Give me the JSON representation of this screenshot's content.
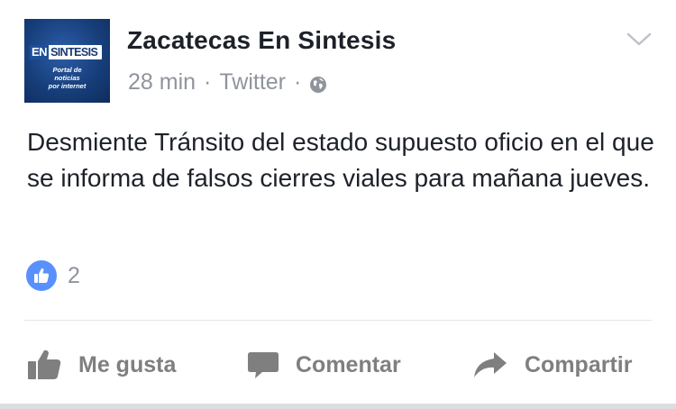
{
  "post": {
    "page_name": "Zacatecas En Sintesis",
    "time": "28 min",
    "separator": "·",
    "source": "Twitter",
    "privacy_icon": "globe-icon",
    "text": "Desmiente Tránsito del estado supuesto oficio en el que se informa de falsos cierres viales para mañana jueves.",
    "avatar": {
      "logo_en": "EN",
      "logo_word": "SINTESIS",
      "tagline": "Portal de\nnoticias\npor internet"
    }
  },
  "reactions": {
    "count": "2",
    "icon": "like-icon"
  },
  "actions": {
    "like_label": "Me gusta",
    "comment_label": "Comentar",
    "share_label": "Compartir"
  },
  "colors": {
    "text": "#1d2129",
    "meta": "#90949c",
    "like_badge": "#5890ff",
    "action": "#7f7f7f"
  }
}
